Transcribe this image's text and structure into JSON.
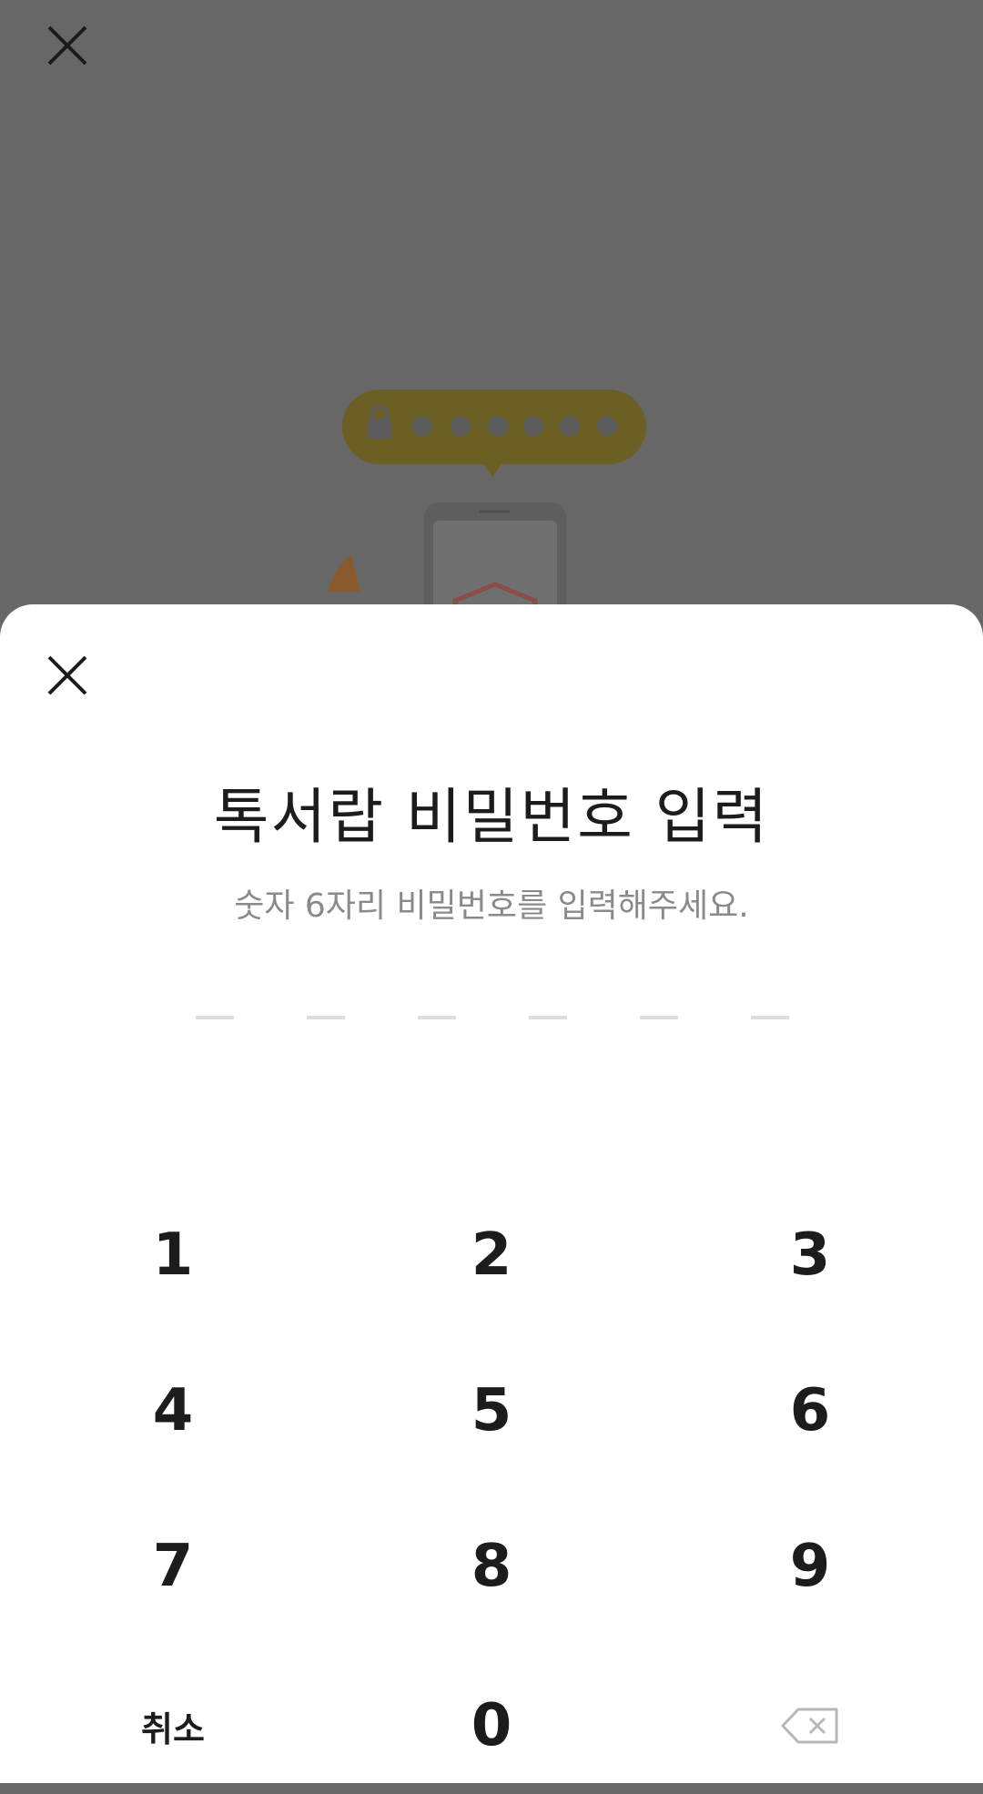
{
  "backdrop": {
    "close_icon": "close-icon",
    "illustration": {
      "bubble_color": "#6c5f25",
      "phone_color": "#5e5e5e",
      "hand_color": "#8a5a2e",
      "shield_color": "#8a4e49"
    }
  },
  "sheet": {
    "close_icon": "close-icon",
    "title": "톡서랍 비밀번호 입력",
    "subtitle": "숫자 6자리 비밀번호를 입력해주세요.",
    "pin_length": 6,
    "keypad": {
      "k1": "1",
      "k2": "2",
      "k3": "3",
      "k4": "4",
      "k5": "5",
      "k6": "6",
      "k7": "7",
      "k8": "8",
      "k9": "9",
      "cancel": "취소",
      "k0": "0",
      "backspace_icon": "backspace-icon"
    }
  },
  "colors": {
    "overlay": "#676767",
    "sheet_bg": "#ffffff",
    "text_primary": "#1c1c1c",
    "text_secondary": "#8a8a8a",
    "pin_slot": "#dddddd"
  }
}
